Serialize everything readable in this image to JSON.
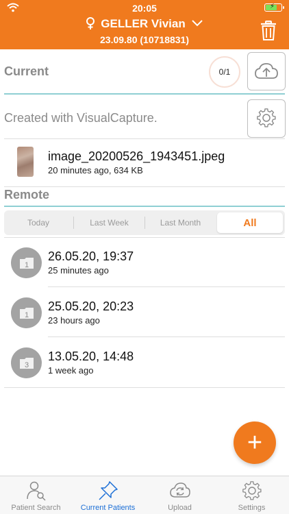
{
  "status_bar": {
    "time": "20:05"
  },
  "header": {
    "patient_name": "GELLER Vivian",
    "patient_info": "23.09.80 (10718831)"
  },
  "current": {
    "title": "Current",
    "counter": "0/1",
    "description": "Created with VisualCapture.",
    "file": {
      "name": "image_20200526_1943451.jpeg",
      "meta": "20 minutes ago, 634 KB"
    }
  },
  "remote": {
    "title": "Remote",
    "filters": [
      "Today",
      "Last Week",
      "Last Month",
      "All"
    ],
    "selected_filter": "All",
    "items": [
      {
        "date": "26.05.20, 19:37",
        "ago": "25 minutes ago",
        "count": "1"
      },
      {
        "date": "25.05.20, 20:23",
        "ago": "23 hours ago",
        "count": "1"
      },
      {
        "date": "13.05.20, 14:48",
        "ago": "1 week ago",
        "count": "3"
      }
    ]
  },
  "fab": {
    "label": "+"
  },
  "tabs": [
    {
      "label": "Patient Search",
      "icon": "person-search-icon"
    },
    {
      "label": "Current Patients",
      "icon": "pin-icon"
    },
    {
      "label": "Upload",
      "icon": "cloud-sync-icon"
    },
    {
      "label": "Settings",
      "icon": "gear-icon"
    }
  ],
  "active_tab": "Current Patients",
  "colors": {
    "accent": "#f07a1e",
    "teal": "#8fcfd3",
    "tab_active": "#1c6fd6"
  }
}
